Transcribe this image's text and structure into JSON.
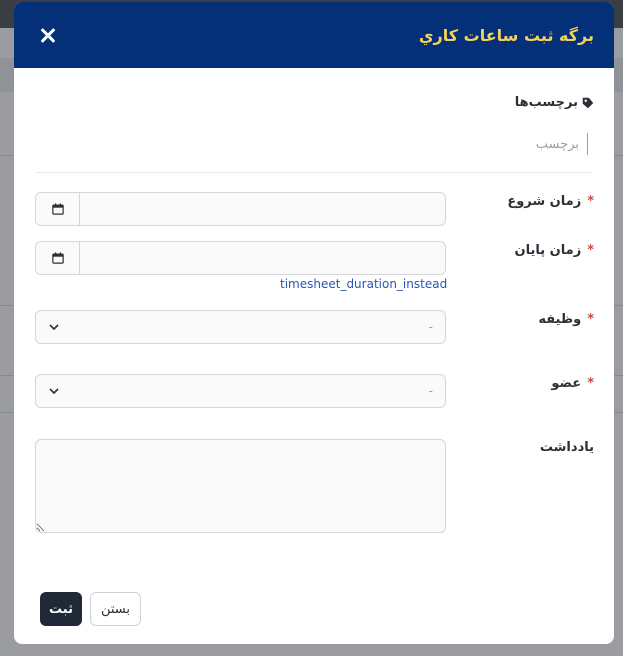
{
  "modal": {
    "title": "برگه ثبت ساعات كاري"
  },
  "form": {
    "tags": {
      "label": "برچسب‌ها",
      "placeholder": "برچسب"
    },
    "start_time": {
      "label": "زمان شروع",
      "required": "*"
    },
    "end_time": {
      "label": "زمان پايان",
      "required": "*"
    },
    "helper_link": "timesheet_duration_instead",
    "task": {
      "label": "وظيفه",
      "required": "*",
      "value": "-"
    },
    "member": {
      "label": "عضو",
      "required": "*",
      "value": "-"
    },
    "note": {
      "label": "يادداشت"
    }
  },
  "buttons": {
    "submit": "ثبت",
    "close": "بستن"
  },
  "colors": {
    "header_bg": "#04307a",
    "title": "#f2d25a",
    "required": "#d64545",
    "link": "#2a56b5",
    "submit_bg": "#1f2937"
  }
}
